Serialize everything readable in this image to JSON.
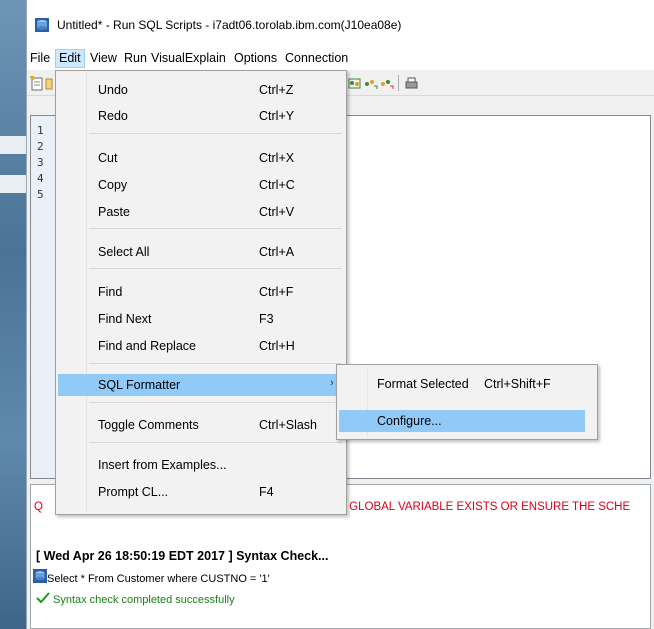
{
  "window": {
    "title": "Untitled* - Run SQL Scripts - i7adt06.torolab.ibm.com(J10ea08e)"
  },
  "menubar": [
    "File",
    "Edit",
    "View",
    "Run",
    "VisualExplain",
    "Options",
    "Connection"
  ],
  "editor": {
    "line_numbers": [
      "1",
      "2",
      "3",
      "4",
      "5"
    ]
  },
  "edit_menu": {
    "items": [
      {
        "label": "Undo",
        "shortcut": "Ctrl+Z"
      },
      {
        "label": "Redo",
        "shortcut": "Ctrl+Y"
      },
      {
        "label": "Cut",
        "shortcut": "Ctrl+X"
      },
      {
        "label": "Copy",
        "shortcut": "Ctrl+C"
      },
      {
        "label": "Paste",
        "shortcut": "Ctrl+V"
      },
      {
        "label": "Select All",
        "shortcut": "Ctrl+A"
      },
      {
        "label": "Find",
        "shortcut": "Ctrl+F"
      },
      {
        "label": "Find Next",
        "shortcut": "F3"
      },
      {
        "label": "Find and Replace",
        "shortcut": "Ctrl+H"
      },
      {
        "label": "SQL Formatter",
        "shortcut": ""
      },
      {
        "label": "Toggle Comments",
        "shortcut": "Ctrl+Slash"
      },
      {
        "label": "Insert from Examples...",
        "shortcut": ""
      },
      {
        "label": "Prompt CL...",
        "shortcut": "F4"
      }
    ]
  },
  "submenu": {
    "items": [
      {
        "label": "Format Selected",
        "shortcut": "Ctrl+Shift+F"
      },
      {
        "label": "Configure...",
        "shortcut": ""
      }
    ]
  },
  "messages": {
    "error_prefix": "Q",
    "error_tail": "HE GLOBAL VARIABLE EXISTS OR ENSURE THE SCHE",
    "header": "[ Wed Apr 26 18:50:19 EDT 2017 ]  Syntax Check...",
    "statement": "Select * From Customer where CUSTNO = '1'",
    "success": "Syntax check completed successfully"
  },
  "colors": {
    "highlight": "#91c9f7",
    "error": "#d8001b",
    "success": "#1a7f1a"
  }
}
